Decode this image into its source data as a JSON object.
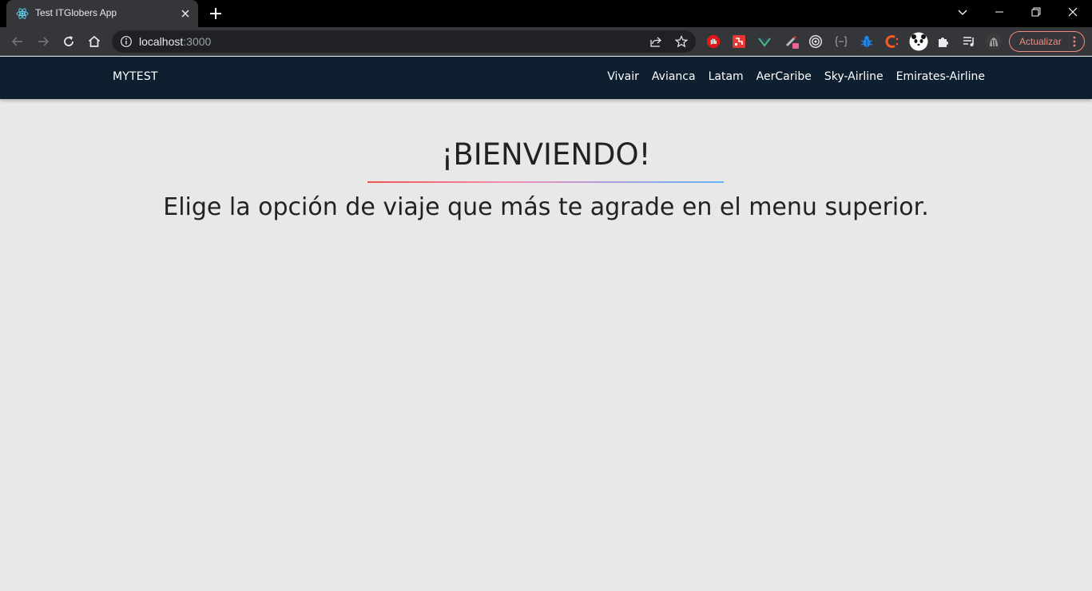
{
  "browser": {
    "tab_title": "Test ITGlobers App",
    "url_host": "localhost",
    "url_port": ":3000",
    "update_label": "Actualizar"
  },
  "icons": {
    "tab": "react-icon",
    "tab_close": "close-icon",
    "new_tab": "plus-icon",
    "tab_search": "chevron-down-icon",
    "minimize": "minimize-icon",
    "restore": "restore-icon",
    "close_window": "close-icon",
    "back": "arrow-left-icon",
    "forward": "arrow-right-icon",
    "reload": "reload-icon",
    "home": "home-icon",
    "site_info": "info-icon",
    "share": "share-icon",
    "bookmark": "star-icon",
    "extensions": [
      "adblock-icon",
      "puzzle-red-icon",
      "vue-devtools-icon",
      "color-picker-icon",
      "target-icon",
      "json-icon",
      "bug-icon",
      "c-extension-icon",
      "panda-icon",
      "puzzle-icon",
      "playlist-icon",
      "avatar-icon"
    ],
    "menu": "more-vert-icon"
  },
  "colors": {
    "navbar": "#0e1f2f",
    "page_bg": "#e8e8e8",
    "update_accent": "#f28b82",
    "underline_start": "#ef5350",
    "underline_end": "#64b5f6"
  },
  "navbar": {
    "brand": "MYTEST",
    "links": [
      "Vivair",
      "Avianca",
      "Latam",
      "AerCaribe",
      "Sky-Airline",
      "Emirates-Airline"
    ]
  },
  "hero": {
    "title": "¡BIENVIENDO!",
    "subtitle": "Elige la opción de viaje que más te agrade en el menu superior."
  }
}
